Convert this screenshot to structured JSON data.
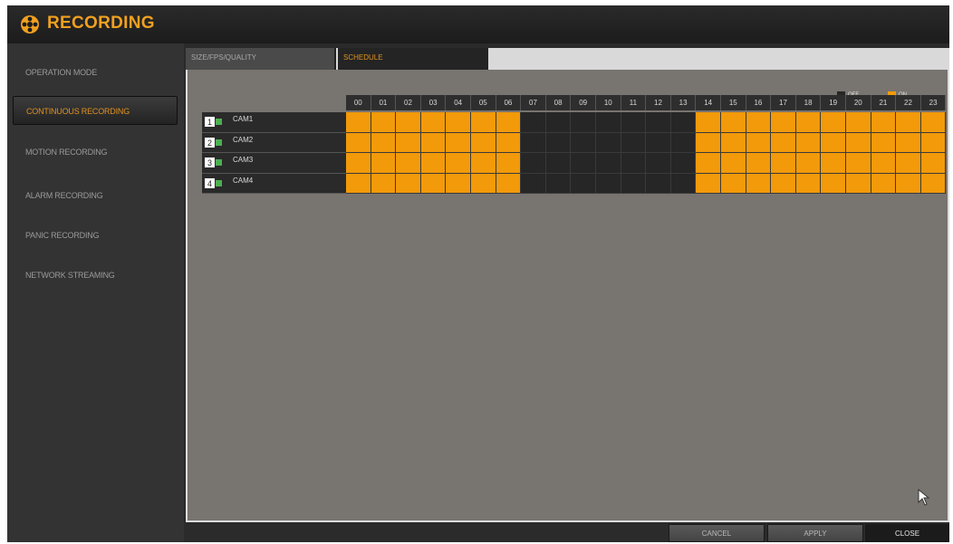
{
  "window": {
    "title": "RECORDING",
    "title_icon": "film-reel-icon",
    "accent_color": "#f0a020"
  },
  "sidebar": {
    "items": [
      {
        "label": "OPERATION MODE",
        "active": false
      },
      {
        "label": "CONTINUOUS RECORDING",
        "active": true
      },
      {
        "label": "MOTION RECORDING",
        "active": false
      },
      {
        "label": "ALARM RECORDING",
        "active": false
      },
      {
        "label": "PANIC RECORDING",
        "active": false
      },
      {
        "label": "NETWORK STREAMING",
        "active": false
      }
    ]
  },
  "tabs": [
    {
      "label": "SIZE/FPS/QUALITY",
      "active": false
    },
    {
      "label": "SCHEDULE",
      "active": true
    }
  ],
  "legend": {
    "off_label": "OFF",
    "on_label": "ON",
    "off_color": "#262626",
    "on_color": "#f29a0a"
  },
  "schedule": {
    "hours": [
      "00",
      "01",
      "02",
      "03",
      "04",
      "05",
      "06",
      "07",
      "08",
      "09",
      "10",
      "11",
      "12",
      "13",
      "14",
      "15",
      "16",
      "17",
      "18",
      "19",
      "20",
      "21",
      "22",
      "23"
    ],
    "cameras": [
      {
        "number": "1",
        "name": "CAM1",
        "hours_on": [
          1,
          1,
          1,
          1,
          1,
          1,
          1,
          0,
          0,
          0,
          0,
          0,
          0,
          0,
          1,
          1,
          1,
          1,
          1,
          1,
          1,
          1,
          1,
          1
        ]
      },
      {
        "number": "2",
        "name": "CAM2",
        "hours_on": [
          1,
          1,
          1,
          1,
          1,
          1,
          1,
          0,
          0,
          0,
          0,
          0,
          0,
          0,
          1,
          1,
          1,
          1,
          1,
          1,
          1,
          1,
          1,
          1
        ]
      },
      {
        "number": "3",
        "name": "CAM3",
        "hours_on": [
          1,
          1,
          1,
          1,
          1,
          1,
          1,
          0,
          0,
          0,
          0,
          0,
          0,
          0,
          1,
          1,
          1,
          1,
          1,
          1,
          1,
          1,
          1,
          1
        ]
      },
      {
        "number": "4",
        "name": "CAM4",
        "hours_on": [
          1,
          1,
          1,
          1,
          1,
          1,
          1,
          0,
          0,
          0,
          0,
          0,
          0,
          0,
          1,
          1,
          1,
          1,
          1,
          1,
          1,
          1,
          1,
          1
        ]
      }
    ]
  },
  "buttons": {
    "cancel": "CANCEL",
    "apply": "APPLY",
    "close": "CLOSE"
  }
}
